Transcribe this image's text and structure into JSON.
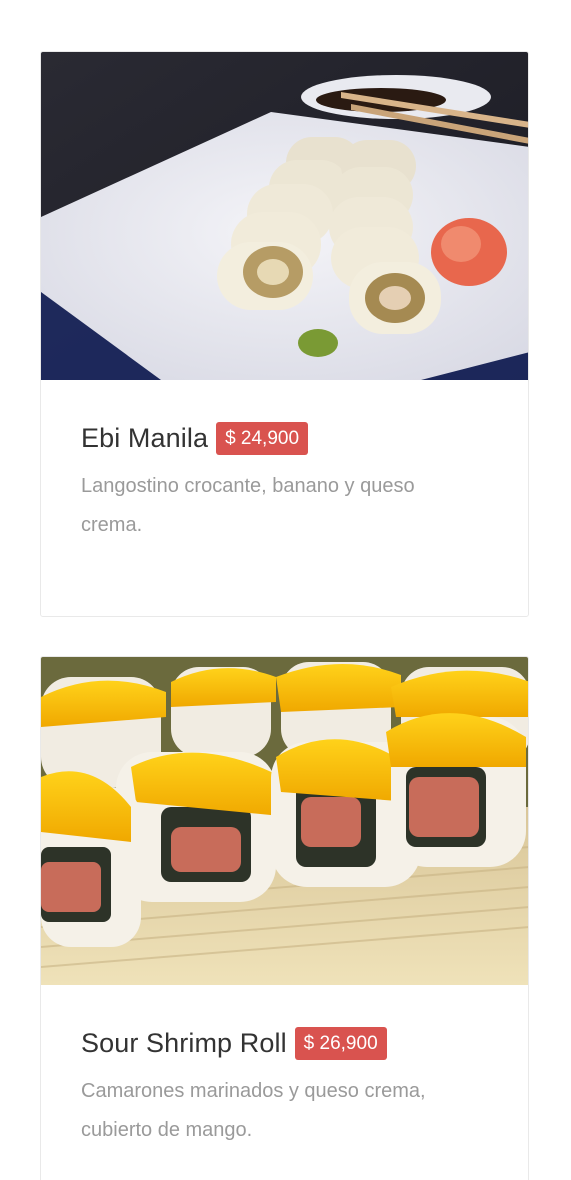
{
  "menu": {
    "items": [
      {
        "name": "Ebi Manila",
        "price": "$ 24,900",
        "description": "Langostino crocante, banano y queso crema.",
        "image_subject": "shrimp sushi rolls on white plate with chopsticks, wasabi and ginger"
      },
      {
        "name": "Sour Shrimp Roll",
        "price": "$ 26,900",
        "description": "Camarones marinados y queso crema, cubierto de mango.",
        "image_subject": "sushi rolls topped with mango on bamboo mat"
      }
    ]
  },
  "colors": {
    "price_badge": "#d9534f",
    "title_text": "#333333",
    "description_text": "#9a9a9a",
    "card_border": "#e9e9e9"
  }
}
